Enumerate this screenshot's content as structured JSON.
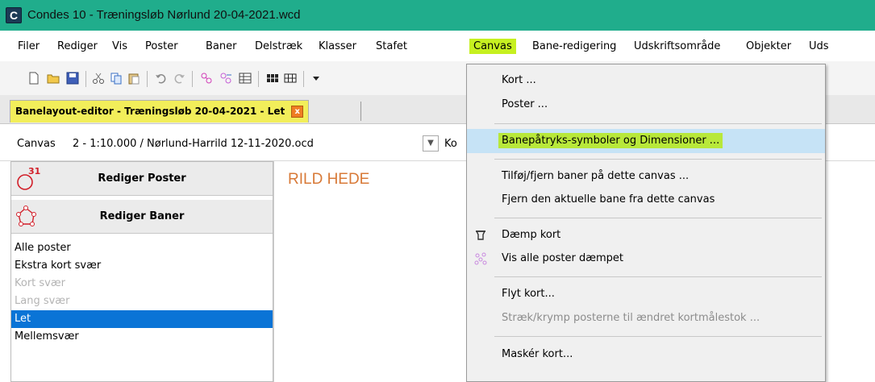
{
  "window": {
    "title": "Condes 10 - Træningsløb Nørlund 20-04-2021.wcd",
    "icon_letter": "C",
    "titlebar_color": "#20ad8c"
  },
  "menubar": {
    "items": [
      "Filer",
      "Rediger",
      "Vis",
      "Poster",
      "Baner",
      "Delstræk",
      "Klasser",
      "Stafet",
      "Canvas",
      "Bane-redigering",
      "Udskriftsområde",
      "Objekter",
      "Uds"
    ],
    "active": "Canvas",
    "highlight_color": "#c6f020"
  },
  "toolbar": {
    "icons": [
      "new-icon",
      "open-icon",
      "save-icon",
      "cut-icon",
      "copy-icon",
      "paste-icon",
      "undo-icon",
      "redo-icon",
      "add-controls-icon",
      "remove-controls-icon",
      "table-icon",
      "grid-icon",
      "grid-lines-icon",
      "dropdown-icon"
    ]
  },
  "tab": {
    "label": "Banelayout-editor - Træningsløb 20-04-2021 - Let",
    "close": "x",
    "color": "#f2ee5a"
  },
  "canvas_selector": {
    "label": "Canvas",
    "value": "2 - 1:10.000 / Nørlund-Harrild 12-11-2020.ocd",
    "next_label": "Ko"
  },
  "left_panel": {
    "edit_controls_label": "Rediger Poster",
    "edit_controls_badge": "31",
    "edit_courses_label": "Rediger Baner",
    "courses": [
      {
        "name": "Alle poster",
        "state": "normal"
      },
      {
        "name": "Ekstra kort svær",
        "state": "normal"
      },
      {
        "name": "Kort svær",
        "state": "dim"
      },
      {
        "name": "Lang svær",
        "state": "dim"
      },
      {
        "name": "Let",
        "state": "selected"
      },
      {
        "name": "Mellemsvær",
        "state": "normal"
      }
    ],
    "selected_color": "#0a74d6"
  },
  "map": {
    "label": "RILD HEDE"
  },
  "canvas_menu": {
    "items": [
      {
        "label": "Kort ...",
        "state": "normal",
        "icon": ""
      },
      {
        "label": "Poster ...",
        "state": "normal",
        "icon": ""
      },
      {
        "label": "Banepåtryks-symboler og Dimensioner ...",
        "state": "hover",
        "icon": ""
      },
      {
        "label": "Tilføj/fjern baner på dette canvas ...",
        "state": "normal",
        "icon": ""
      },
      {
        "label": "Fjern den aktuelle bane fra dette canvas",
        "state": "normal",
        "icon": ""
      },
      {
        "label": "Dæmp kort",
        "state": "normal",
        "icon": "dim-map-icon"
      },
      {
        "label": "Vis alle poster dæmpet",
        "state": "normal",
        "icon": "dim-controls-icon"
      },
      {
        "label": "Flyt kort...",
        "state": "normal",
        "icon": ""
      },
      {
        "label": "Stræk/krymp posterne til ændret kortmålestok ...",
        "state": "disabled",
        "icon": ""
      },
      {
        "label": "Maskér kort...",
        "state": "normal",
        "icon": ""
      }
    ],
    "hover_color": "#c6e3f6",
    "highlight_color": "#b8e83a"
  }
}
